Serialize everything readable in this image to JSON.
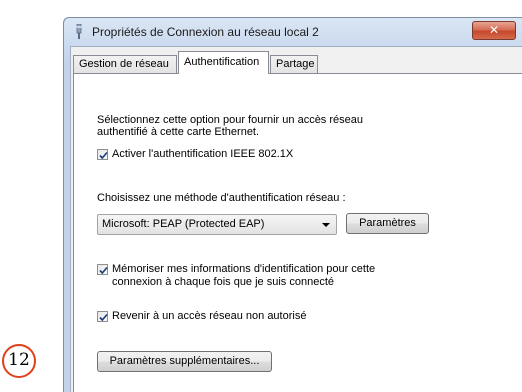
{
  "window": {
    "title": "Propriétés de Connexion au réseau local 2",
    "close_label": "✕"
  },
  "tabs": [
    {
      "label": "Gestion de réseau",
      "active": false
    },
    {
      "label": "Authentification",
      "active": true
    },
    {
      "label": "Partage",
      "active": false
    }
  ],
  "panel": {
    "intro_line1": "Sélectionnez cette option pour fournir un accès réseau",
    "intro_line2": "authentifié à cette carte Ethernet.",
    "enable_8021x": {
      "label": "Activer l'authentification IEEE 802.1X",
      "checked": true
    },
    "method_label": "Choisissez une méthode d'authentification réseau :",
    "method_select": {
      "value": "Microsoft: PEAP (Protected EAP)"
    },
    "settings_button": "Paramètres",
    "remember": {
      "line1": "Mémoriser mes informations d'identification pour cette",
      "line2": "connexion à chaque fois que je suis connecté",
      "checked": true
    },
    "fallback": {
      "label": "Revenir à un accès réseau non autorisé",
      "checked": true
    },
    "additional_button": "Paramètres supplémentaires..."
  },
  "annotation": {
    "number": "12",
    "color": "#e0401a"
  },
  "icons": {
    "title": "network-connection-icon",
    "close": "close-icon",
    "checkbox": "checkmark-icon",
    "dropdown": "chevron-down-icon"
  }
}
